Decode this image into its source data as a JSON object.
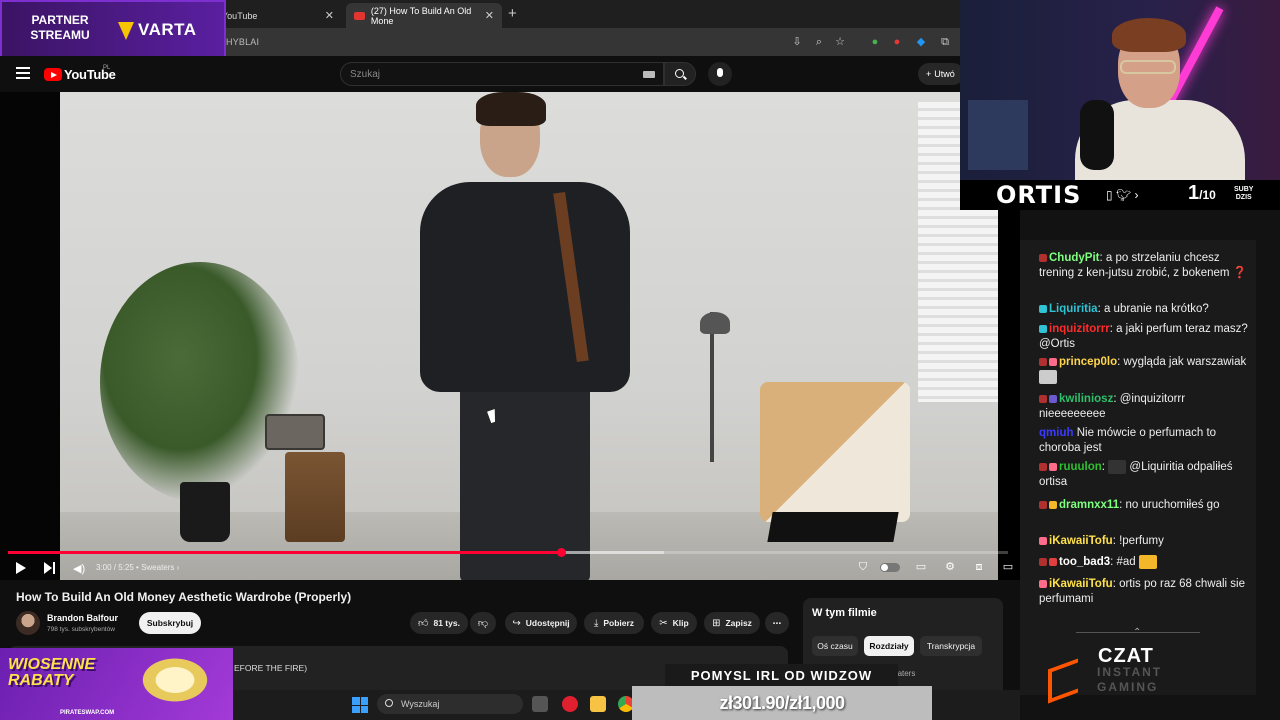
{
  "browser": {
    "tabs": [
      {
        "label": "YouTube",
        "active": false
      },
      {
        "label": "(27) How To Build An Old Mone",
        "active": true
      }
    ],
    "new_tab": "+",
    "close_glyph": "✕",
    "url_fragment": "HYBLAI"
  },
  "partner": {
    "line1": "PARTNER",
    "line2": "STREAMU",
    "brand": "VARTA"
  },
  "youtube": {
    "logo_text": "YouTube",
    "region": "PL",
    "search_placeholder": "Szukaj",
    "create_label": "Utwó",
    "create_glyph": "+"
  },
  "player": {
    "time": "3:00 / 5:25",
    "chapter": "• Sweaters ›",
    "progress_fraction": 0.553,
    "buffer_fraction": 0.656
  },
  "video": {
    "title": "How To Build An Old Money Aesthetic Wardrobe (Properly)",
    "channel": "Brandon Balfour",
    "subscribers": "798 tys. subskrybentów",
    "subscribe_label": "Subskrybuj",
    "likes": "81 tys.",
    "share_label": "Udostępnij",
    "download_label": "Pobierz",
    "clip_label": "Klip",
    "save_label": "Zapisz",
    "more_glyph": "⋯",
    "desc_fragment": "EFORE THE FIRE)"
  },
  "chapters_panel": {
    "title": "W tym filmie",
    "chips": [
      "Oś czasu",
      "Rozdziały",
      "Transkrypcja"
    ],
    "selected_chip": "Rozdziały",
    "row_text": "Sweaters"
  },
  "promo": {
    "line1": "WIOSENNE",
    "line2": "RABATY",
    "url": "PIRATESWAP.COM"
  },
  "taskbar": {
    "search_label": "Wyszukaj"
  },
  "stream_overlay": {
    "idea_label": "POMYSL IRL OD WIDZOW",
    "goal": "zł301.90/zł1,000"
  },
  "streamer": {
    "name": "ORTIS",
    "subs_current": "1",
    "subs_target": "/10",
    "subs_label_1": "SUBY",
    "subs_label_2": "DZIS"
  },
  "chat": {
    "messages": [
      {
        "user": "ChudyPit",
        "color": "#7fff7f",
        "text": "a po strzelaniu chcesz trening z ken-jutsu zrobić, z bokenem ❓"
      },
      {
        "user": "Liquiritia",
        "color": "#2ec4d6",
        "text": "a ubranie na krótko?"
      },
      {
        "user": "inquizitorrr",
        "color": "#ff2b2b",
        "text": "a jaki perfum teraz masz? @Ortis"
      },
      {
        "user": "princep0lo",
        "color": "#ffd54a",
        "text": "wygląda jak warszawiak"
      },
      {
        "user": "kwiliniosz",
        "color": "#2fbf6b",
        "text": "@inquizitorrr nieeeeeeeee"
      },
      {
        "user": "qmiuh",
        "color": "#3b3bff",
        "text": "Nie mówcie o perfumach to choroba jest"
      },
      {
        "user": "ruuulon",
        "color": "#2fbf2f",
        "text": "@Liquiritia odpaliłeś ortisa"
      },
      {
        "user": "dramnxx11",
        "color": "#7fff7f",
        "text": "no uruchomiłeś go"
      },
      {
        "user": "iKawaiiTofu",
        "color": "#ffe14a",
        "text": "!perfumy"
      },
      {
        "user": "too_bad3",
        "color": "#ffffff",
        "text": "#ad"
      },
      {
        "user": "iKawaiiTofu",
        "color": "#ffe14a",
        "text": "ortis po raz 68 chwali sie perfumami"
      }
    ],
    "footer_title": "CZAT",
    "footer_sub_1": "INSTANT",
    "footer_sub_2": "GAMING"
  }
}
